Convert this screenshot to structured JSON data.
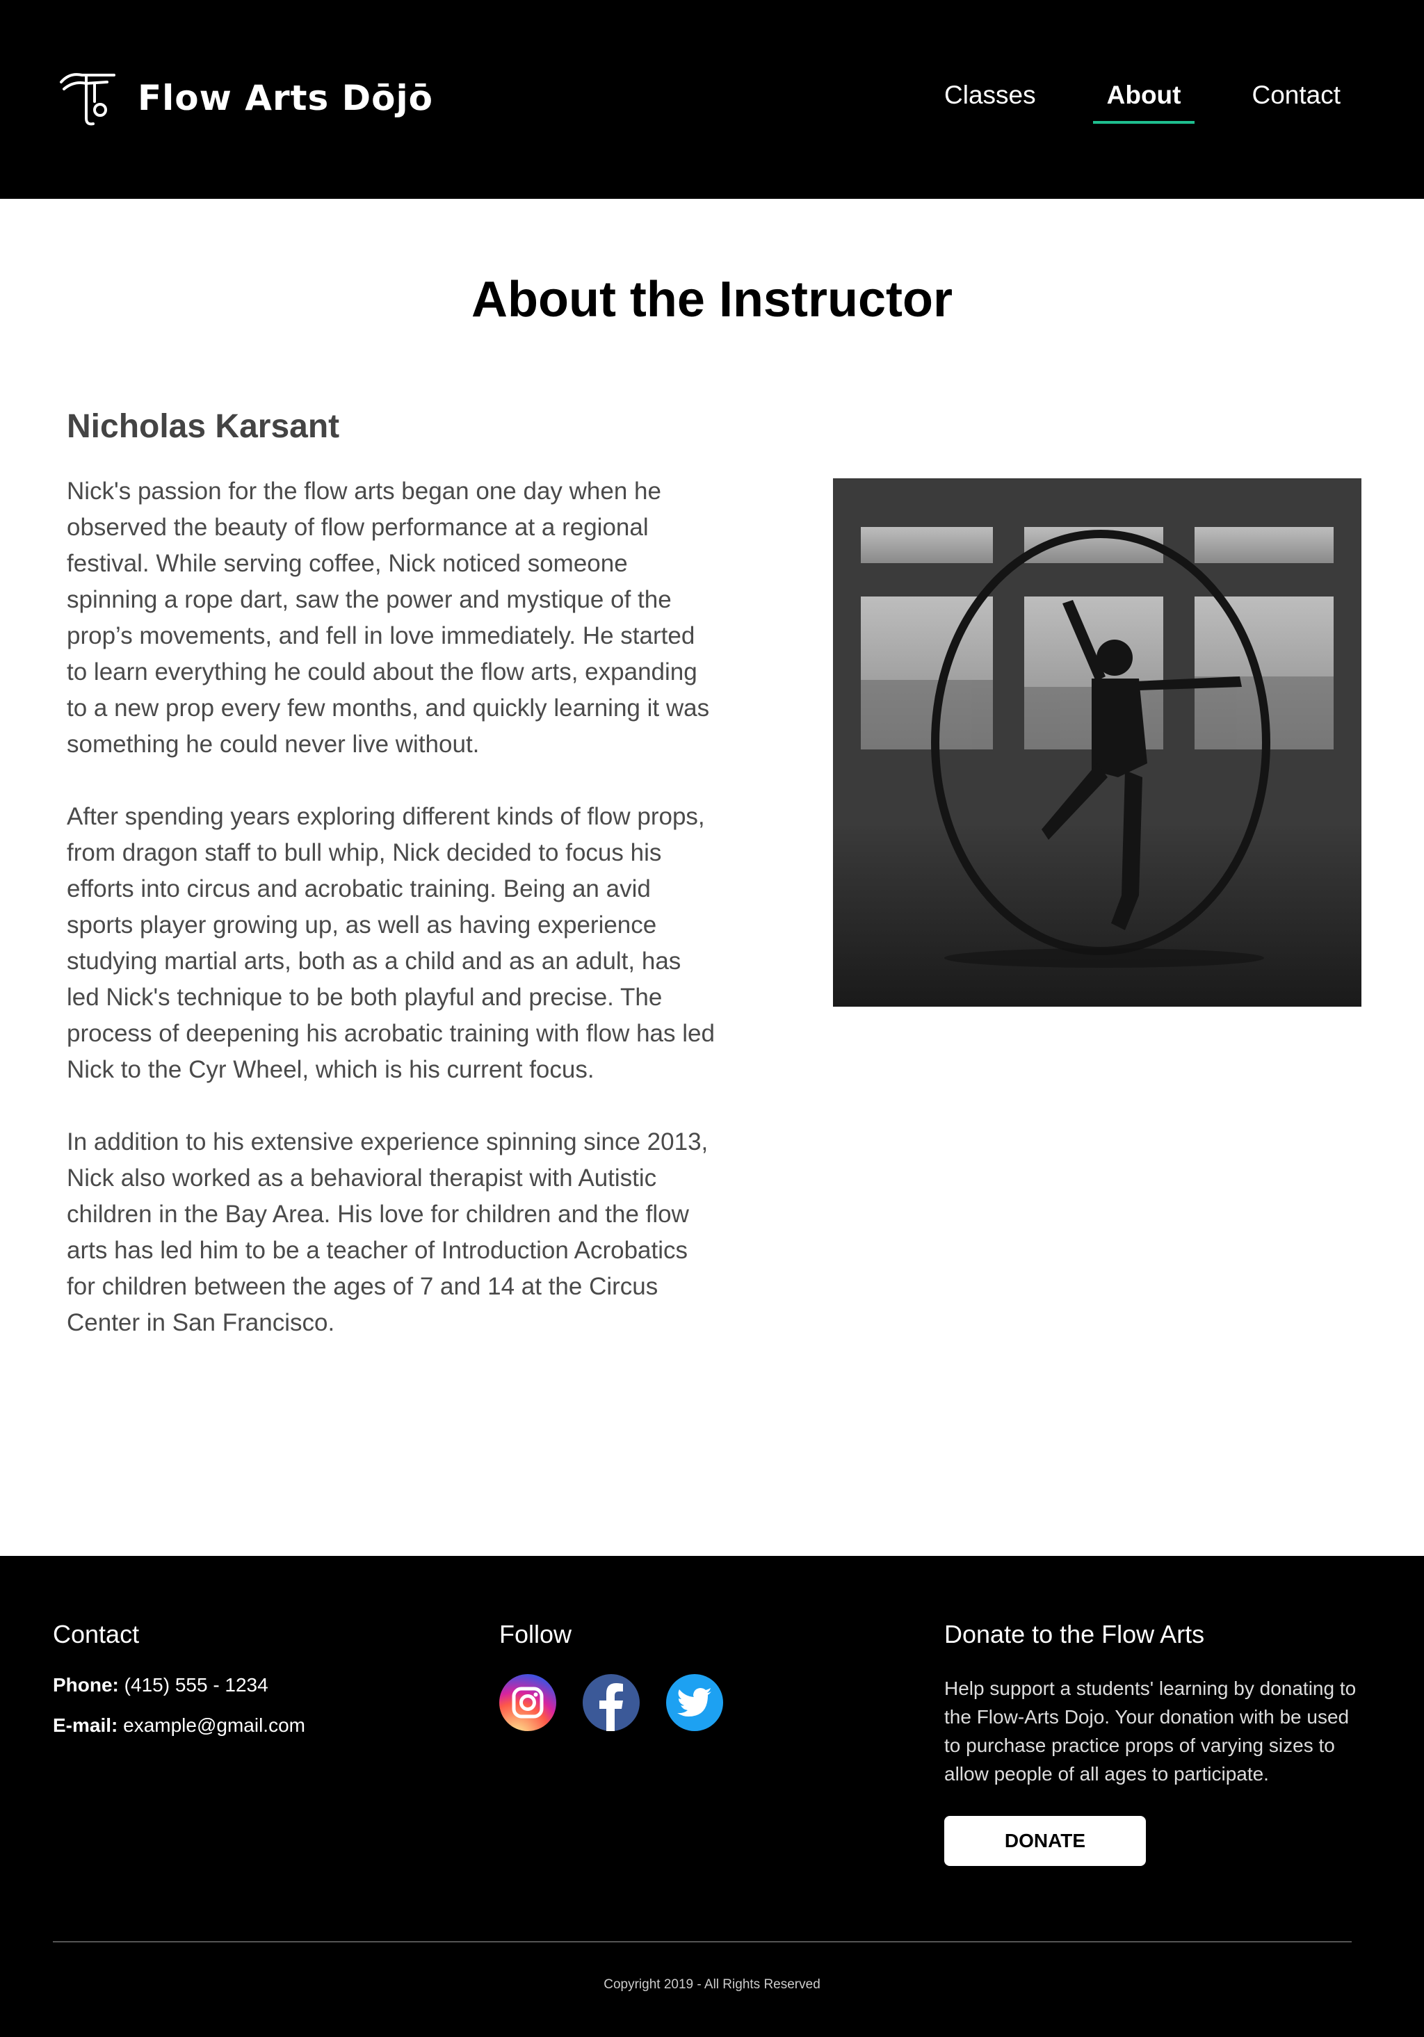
{
  "brand": {
    "name": "Flow Arts Dōjō",
    "accent_color": "#1fbf8f"
  },
  "nav": {
    "items": [
      {
        "label": "Classes"
      },
      {
        "label": "About"
      },
      {
        "label": "Contact"
      }
    ],
    "active": "About"
  },
  "main": {
    "title": "About the Instructor",
    "instructor_name": "Nicholas Karsant",
    "paragraphs": [
      "Nick's passion for the flow arts began one day when he observed the beauty of flow performance at a regional festival. While serving coffee, Nick noticed someone spinning a rope dart, saw the power and mystique of the prop’s movements, and fell in love immediately. He started to learn everything he could about the flow arts, expanding to a new prop every few months, and quickly learning it was something he could never live without.",
      "After spending years exploring different kinds of flow props, from dragon staff to bull whip, Nick decided to focus his efforts into circus and acrobatic training. Being an avid sports player growing up, as well as having experience studying martial arts, both as a child and as an adult, has led Nick's technique to be both playful and precise. The process of deepening his acrobatic training with flow has led Nick to the Cyr Wheel, which is his current focus.",
      "In addition to his extensive experience spinning since 2013, Nick also worked as a behavioral therapist with Autistic children in the Bay Area. His love for children and the flow arts has led him to be a teacher of Introduction Acrobatics for children between the ages of 7 and 14 at the Circus Center in San Francisco."
    ]
  },
  "footer": {
    "contact": {
      "title": "Contact",
      "phone_label": "Phone:",
      "phone": "(415) 555 - 1234",
      "email_label": "E-mail:",
      "email": "example@gmail.com"
    },
    "follow": {
      "title": "Follow",
      "icons": [
        "instagram-icon",
        "facebook-icon",
        "twitter-icon"
      ]
    },
    "donate": {
      "title": "Donate to the Flow Arts",
      "text": "Help support a students' learning by donating to the Flow-Arts Dojo. Your donation with be used to purchase practice props of varying sizes to allow people of all ages to participate.",
      "button_label": "DONATE"
    },
    "copyright": "Copyright 2019 - All Rights Reserved"
  }
}
